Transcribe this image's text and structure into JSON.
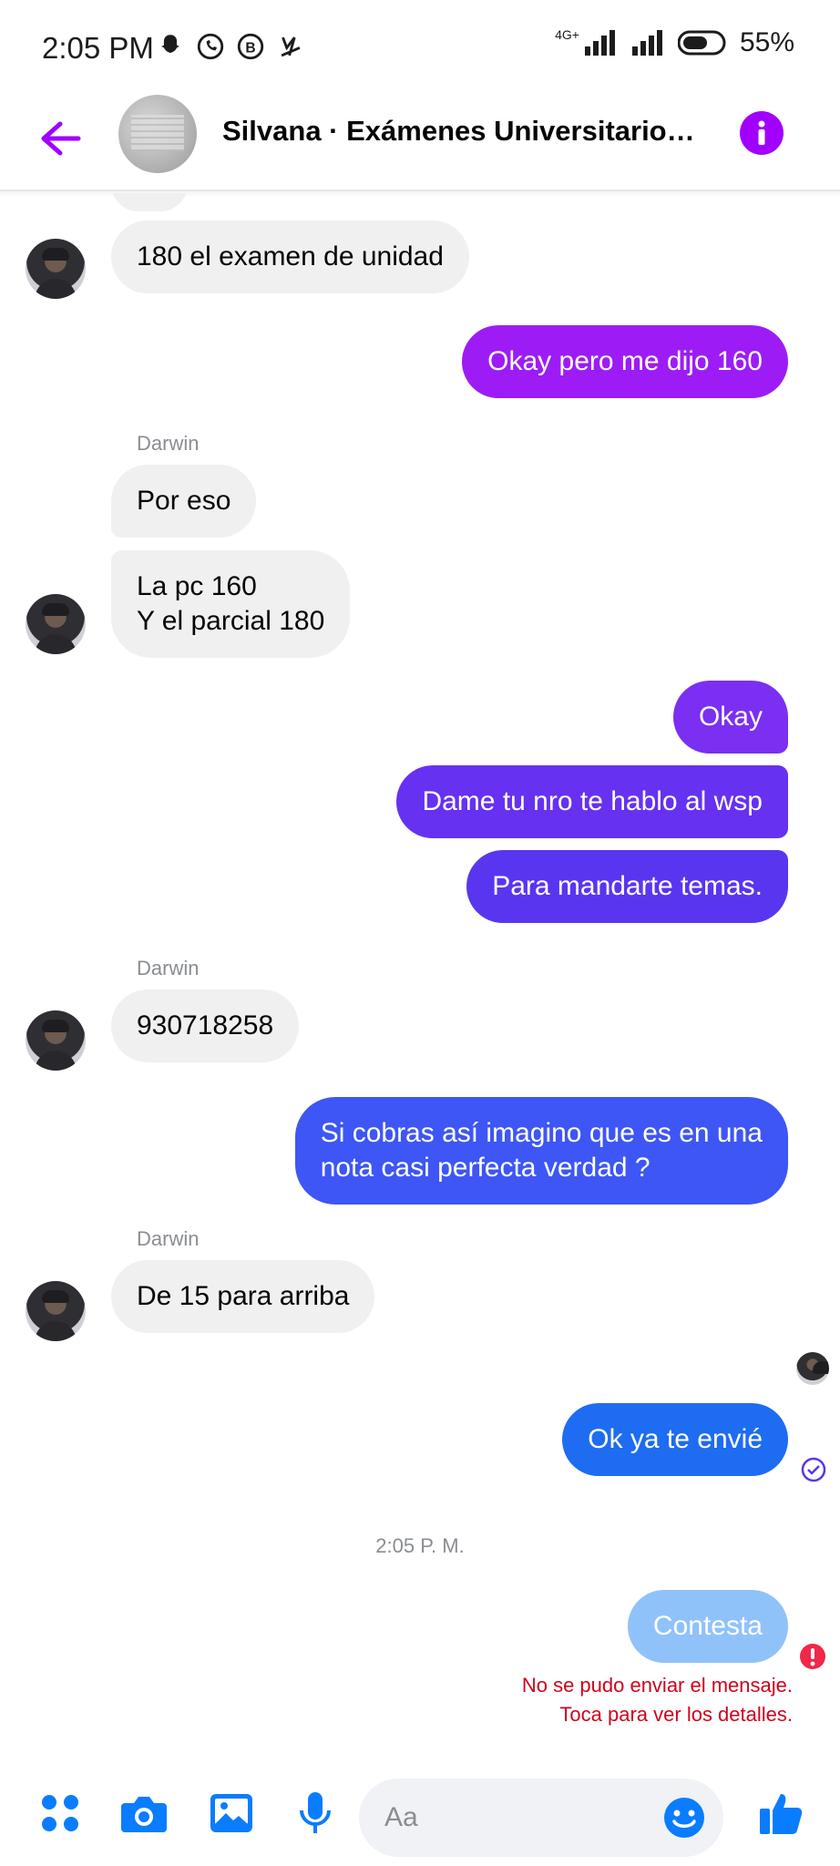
{
  "status_bar": {
    "time": "2:05 PM",
    "network": "4G+",
    "battery": "55%",
    "icons": [
      "snapchat-icon",
      "whatsapp-icon",
      "business-icon",
      "app-y-icon",
      "signal-icon",
      "battery-icon"
    ]
  },
  "header": {
    "title": "Silvana · Exámenes Universitarios ...",
    "accent": "#a100ff"
  },
  "messages": {
    "m1": "180 el examen de unidad",
    "m2": "Okay pero me dijo 160",
    "sender1": "Darwin",
    "m3": "Por eso",
    "m4_line1": "La pc 160",
    "m4_line2": "Y el parcial 180",
    "m5": "Okay",
    "m6": "Dame tu nro te hablo al wsp",
    "m7": "Para mandarte temas.",
    "sender2": "Darwin",
    "m8": "930718258",
    "m9_line1": "Si cobras así imagino que es en una",
    "m9_line2": "nota casi perfecta verdad ?",
    "sender3": "Darwin",
    "m10": "De 15 para arriba",
    "m11": "Ok ya te envié",
    "timestamp": "2:05 P. M.",
    "m12": "Contesta",
    "error_line1": "No se pudo enviar el mensaje.",
    "error_line2": "Toca para ver los detalles."
  },
  "colors": {
    "out_purple": "#9d1cf5",
    "out_violet": "#7a2ff2",
    "out_indigo": "#5a35f0",
    "out_blue": "#3d56f5",
    "out_bright_blue": "#1d6cf2",
    "out_failed": "#90c2fa",
    "incoming_bg": "#f0f0f0",
    "error_red": "#d0021b",
    "icon_blue": "#0a7cff"
  },
  "composer": {
    "placeholder": "Aa"
  }
}
